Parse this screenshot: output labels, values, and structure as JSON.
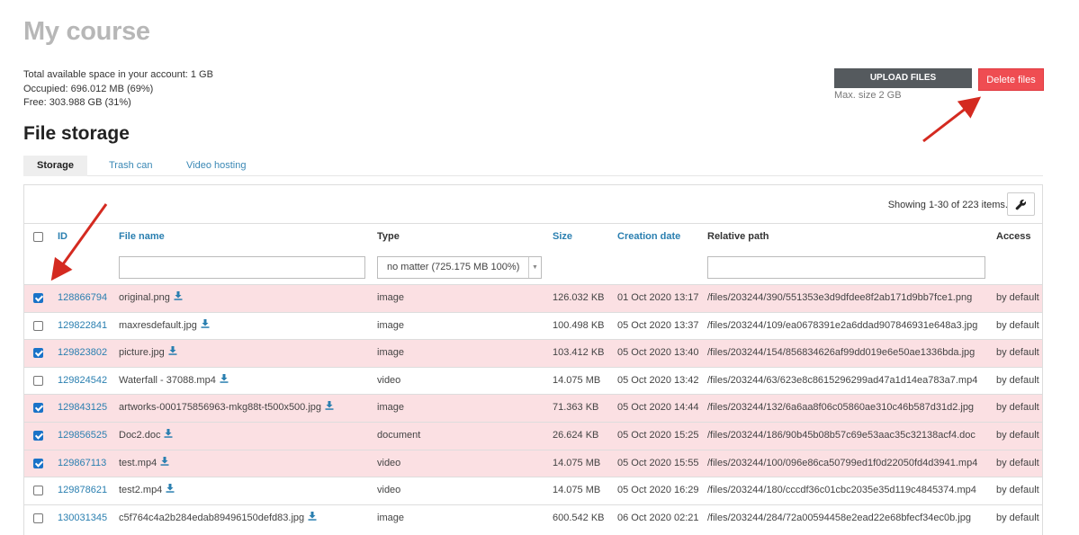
{
  "page": {
    "title": "My course",
    "space_total": "Total available space in your account: 1 GB",
    "space_occupied": "Occupied: 696.012 MB (69%)",
    "space_free": "Free: 303.988 GB (31%)"
  },
  "actions": {
    "upload_label": "UPLOAD FILES",
    "max_size": "Max. size 2 GB",
    "delete_label": "Delete files"
  },
  "section_title": "File storage",
  "tabs": [
    {
      "label": "Storage"
    },
    {
      "label": "Trash can"
    },
    {
      "label": "Video hosting"
    }
  ],
  "table": {
    "summary": "Showing 1-30 of 223 items.",
    "columns": {
      "id": "ID",
      "file_name": "File name",
      "type": "Type",
      "size": "Size",
      "creation_date": "Creation date",
      "relative_path": "Relative path",
      "access": "Access"
    },
    "type_filter": "no matter (725.175 MB 100%)",
    "rows": [
      {
        "checked": true,
        "id": "128866794",
        "name": "original.png",
        "type": "image",
        "size": "126.032 KB",
        "date": "01 Oct 2020 13:17",
        "path": "/files/203244/390/551353e3d9dfdee8f2ab171d9bb7fce1.png",
        "access": "by default"
      },
      {
        "checked": false,
        "id": "129822841",
        "name": "maxresdefault.jpg",
        "type": "image",
        "size": "100.498 KB",
        "date": "05 Oct 2020 13:37",
        "path": "/files/203244/109/ea0678391e2a6ddad907846931e648a3.jpg",
        "access": "by default"
      },
      {
        "checked": true,
        "id": "129823802",
        "name": "picture.jpg",
        "type": "image",
        "size": "103.412 KB",
        "date": "05 Oct 2020 13:40",
        "path": "/files/203244/154/856834626af99dd019e6e50ae1336bda.jpg",
        "access": "by default"
      },
      {
        "checked": false,
        "id": "129824542",
        "name": "Waterfall - 37088.mp4",
        "type": "video",
        "size": "14.075 MB",
        "date": "05 Oct 2020 13:42",
        "path": "/files/203244/63/623e8c8615296299ad47a1d14ea783a7.mp4",
        "access": "by default"
      },
      {
        "checked": true,
        "id": "129843125",
        "name": "artworks-000175856963-mkg88t-t500x500.jpg",
        "type": "image",
        "size": "71.363 KB",
        "date": "05 Oct 2020 14:44",
        "path": "/files/203244/132/6a6aa8f06c05860ae310c46b587d31d2.jpg",
        "access": "by default"
      },
      {
        "checked": true,
        "id": "129856525",
        "name": "Doc2.doc",
        "type": "document",
        "size": "26.624 KB",
        "date": "05 Oct 2020 15:25",
        "path": "/files/203244/186/90b45b08b57c69e53aac35c32138acf4.doc",
        "access": "by default"
      },
      {
        "checked": true,
        "id": "129867113",
        "name": "test.mp4",
        "type": "video",
        "size": "14.075 MB",
        "date": "05 Oct 2020 15:55",
        "path": "/files/203244/100/096e86ca50799ed1f0d22050fd4d3941.mp4",
        "access": "by default"
      },
      {
        "checked": false,
        "id": "129878621",
        "name": "test2.mp4",
        "type": "video",
        "size": "14.075 MB",
        "date": "05 Oct 2020 16:29",
        "path": "/files/203244/180/cccdf36c01cbc2035e35d119c4845374.mp4",
        "access": "by default"
      },
      {
        "checked": false,
        "id": "130031345",
        "name": "c5f764c4a2b284edab89496150defd83.jpg",
        "type": "image",
        "size": "600.542 KB",
        "date": "06 Oct 2020 02:21",
        "path": "/files/203244/284/72a00594458e2ead22e68bfecf34ec0b.jpg",
        "access": "by default"
      }
    ]
  },
  "icons": {
    "download": "download-icon",
    "wrench": "wrench-icon",
    "annotation": "red-arrow-icon"
  },
  "colors": {
    "accent_link": "#2a7fb0",
    "delete": "#ef4d52",
    "selected_row": "#fbe0e3",
    "upload": "#555a5e"
  }
}
